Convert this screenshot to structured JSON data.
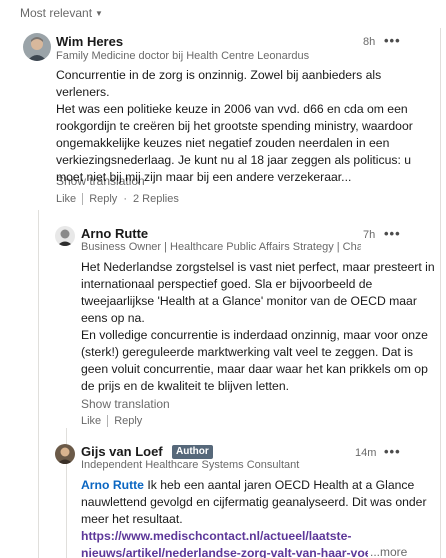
{
  "sort": {
    "label": "Most relevant"
  },
  "comments": [
    {
      "name": "Wim Heres",
      "headline": "Family Medicine doctor bij Health Centre Leonardus",
      "time": "8h",
      "body_lines": [
        "Concurrentie in de zorg is onzinnig. Zowel bij aanbieders als verleners.",
        "Het was een politieke keuze in 2006 van vvd. d66 en cda om een",
        "rookgordijn te creëren bij het grootste spending ministry, waardoor",
        "ongemakkelijke keuzes niet negatief zouden neerdalen in een",
        "verkiezingsnederlaag. Je kunt nu al 18 jaar zeggen als politicus: u",
        "moet niet bij mij zijn maar bij een andere verzekeraar..."
      ],
      "show_translation": "Show translation",
      "like": "Like",
      "reply": "Reply",
      "replies": "2 Replies"
    },
    {
      "name": "Arno Rutte",
      "headline": "Business Owner | Healthcare Public Affairs Strategy | Chairman...",
      "time": "7h",
      "body_lines": [
        "Het Nederlandse zorgstelsel is vast niet perfect, maar presteert in",
        "internationaal perspectief goed. Sla er bijvoorbeeld de",
        "tweejaarlijkse 'Health at a Glance' monitor van de OECD maar",
        "eens op na.",
        "En volledige concurrentie is inderdaad onzinnig, maar voor onze",
        "(sterk!) gereguleerde marktwerking valt veel te zeggen. Dat is",
        "geen voluit concurrentie, maar daar waar het kan prikkels om op",
        "de prijs en de kwaliteit te blijven letten."
      ],
      "show_translation": "Show translation",
      "like": "Like",
      "reply": "Reply"
    },
    {
      "name": "Gijs van Loef",
      "badge": "Author",
      "headline": "Independent Healthcare Systems Consultant",
      "time": "14m",
      "mention": "Arno Rutte",
      "line1_rest": " Ik heb een aantal jaren OECD Health at a Glance",
      "lines": [
        "nauwlettend gevolgd en cijfermatig geanalyseerd. Dit was onder",
        "meer het resultaat."
      ],
      "link_line1": "https://www.medischcontact.nl/actueel/laatste-",
      "link_line2": "nieuws/artikel/nederlandse-zorg-valt-van-haar-voetstuk",
      "more": "...more"
    }
  ],
  "dots": "•••"
}
